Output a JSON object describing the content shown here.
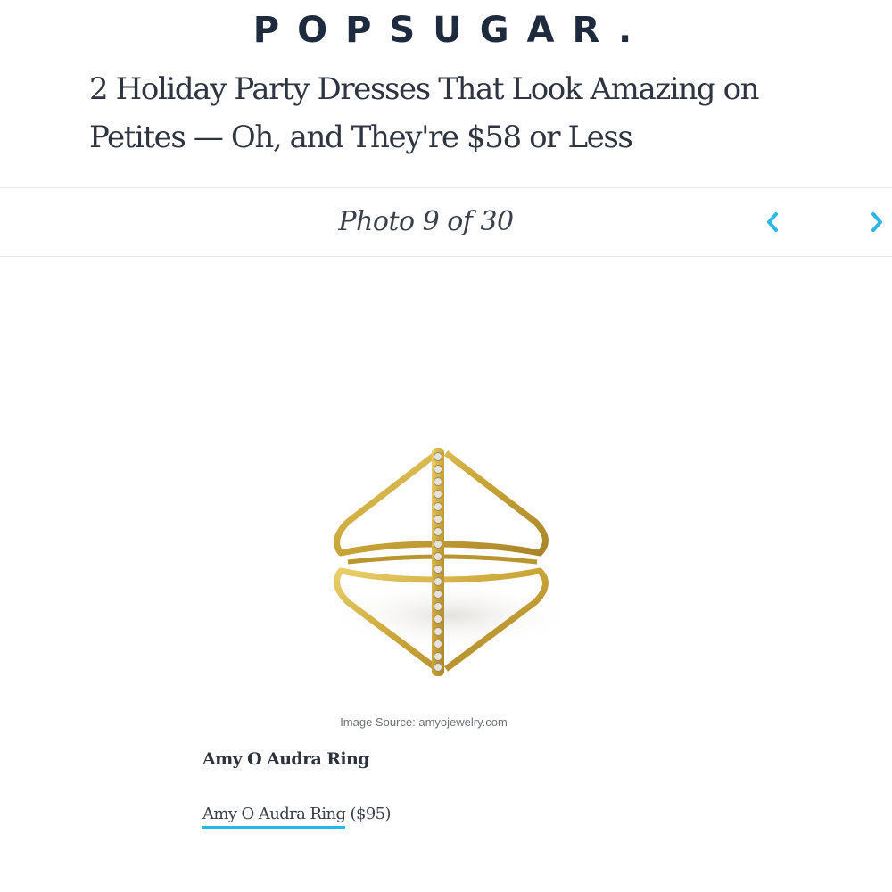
{
  "brand": {
    "logo_text": "POPSUGAR.",
    "accent_color": "#29b6e8"
  },
  "article": {
    "headline": "2 Holiday Party Dresses That Look Amazing on Petites — Oh, and They're $58 or Less"
  },
  "gallery": {
    "counter_text": "Photo 9 of 30",
    "current": 9,
    "total": 30,
    "prev_icon": "chevron-left-icon",
    "next_icon": "chevron-right-icon"
  },
  "photo": {
    "image_source": "Image Source: amyojewelry.com"
  },
  "product": {
    "title": "Amy O Audra Ring",
    "link_label": "Amy O Audra Ring",
    "price": " ($95)"
  }
}
